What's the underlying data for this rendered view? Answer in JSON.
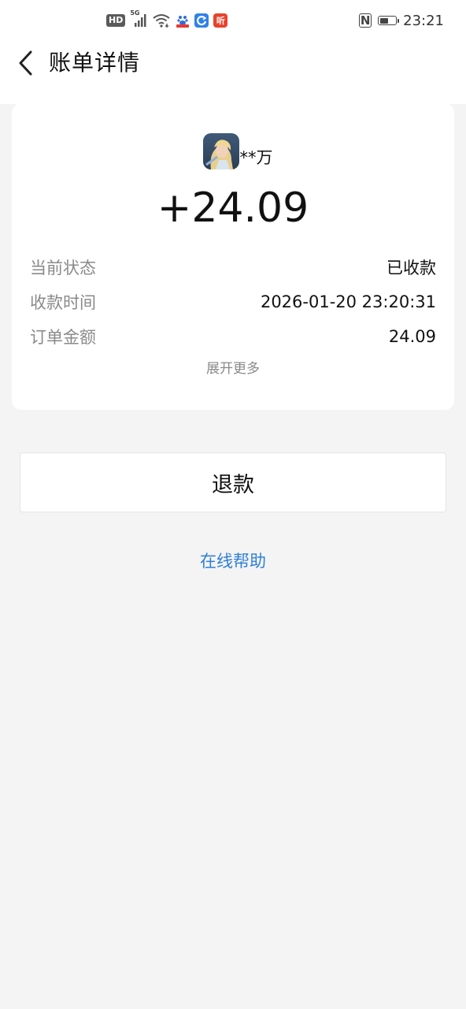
{
  "status_bar": {
    "hd_label": "HD",
    "network_label": "5G",
    "app_icon_label": "听",
    "time": "23:21",
    "battery_level": 0.6
  },
  "header": {
    "title": "账单详情"
  },
  "bill": {
    "payer_name": "**万",
    "amount": "+24.09",
    "rows": [
      {
        "label": "当前状态",
        "value": "已收款"
      },
      {
        "label": "收款时间",
        "value": "2026-01-20 23:20:31"
      },
      {
        "label": "订单金额",
        "value": "24.09"
      }
    ],
    "expand_label": "展开更多"
  },
  "actions": {
    "refund_label": "退款",
    "help_label": "在线帮助"
  },
  "colors": {
    "background": "#f4f4f4",
    "link": "#2f7fd6"
  }
}
